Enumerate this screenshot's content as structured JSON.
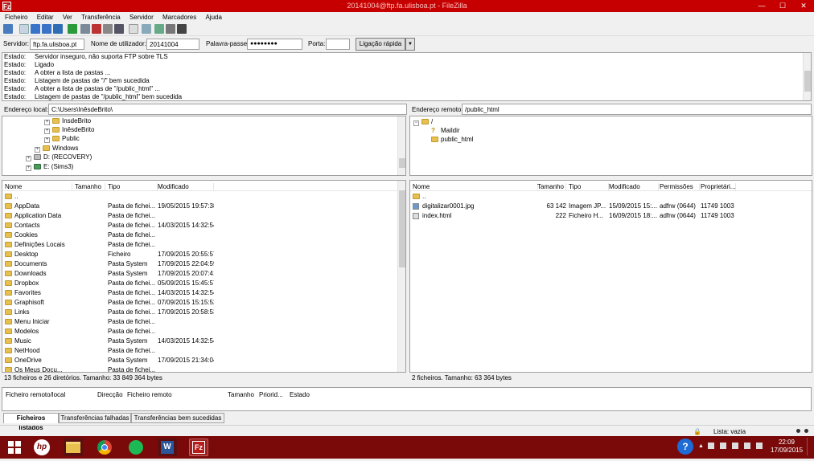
{
  "titlebar": {
    "app_icon": "Fz",
    "title": "20141004@ftp.fa.ulisboa.pt - FileZilla",
    "minimize": "—",
    "maximize": "☐",
    "close": "✕"
  },
  "menu": [
    "Ficheiro",
    "Editar",
    "Ver",
    "Transferência",
    "Servidor",
    "Marcadores",
    "Ajuda"
  ],
  "quickconnect": {
    "host_label": "Servidor:",
    "host_value": "ftp.fa.ulisboa.pt",
    "user_label": "Nome de utilizador:",
    "user_value": "20141004",
    "pass_label": "Palavra-passe:",
    "pass_value": "●●●●●●●●",
    "port_label": "Porta:",
    "port_value": "",
    "connect_label": "Ligação rápida",
    "dropdown_icon": "▼"
  },
  "log": [
    {
      "k": "Estado:",
      "v": "Servidor inseguro, não suporta FTP sobre TLS"
    },
    {
      "k": "Estado:",
      "v": "Ligado"
    },
    {
      "k": "Estado:",
      "v": "A obter a lista de pastas ..."
    },
    {
      "k": "Estado:",
      "v": "Listagem de pastas de \"/\" bem sucedida"
    },
    {
      "k": "Estado:",
      "v": "A obter a lista de pastas de \"/public_html\" ..."
    },
    {
      "k": "Estado:",
      "v": "Listagem de pastas de \"/public_html\" bem sucedida"
    }
  ],
  "local": {
    "addr_label": "Endereço local:",
    "addr_value": "C:\\Users\\InêsdeBrito\\",
    "tree": [
      {
        "label": "InsdeBrito",
        "depth": 5,
        "exp": "+"
      },
      {
        "label": "InêsdeBrito",
        "depth": 5,
        "exp": "+"
      },
      {
        "label": "Public",
        "depth": 5,
        "exp": "+"
      },
      {
        "label": "Windows",
        "depth": 4,
        "exp": "+"
      },
      {
        "label": "D: (RECOVERY)",
        "depth": 3,
        "exp": "+"
      },
      {
        "label": "E: (Sims3)",
        "depth": 3,
        "exp": "+"
      }
    ],
    "columns": [
      "Nome",
      "Tamanho",
      "Tipo",
      "Modificado"
    ],
    "files": [
      {
        "name": "..",
        "size": "",
        "type": "",
        "mod": ""
      },
      {
        "name": "AppData",
        "size": "",
        "type": "Pasta de fichei...",
        "mod": "19/05/2015 19:57:38"
      },
      {
        "name": "Application Data",
        "size": "",
        "type": "Pasta de fichei...",
        "mod": ""
      },
      {
        "name": "Contacts",
        "size": "",
        "type": "Pasta de fichei...",
        "mod": "14/03/2015 14:32:54"
      },
      {
        "name": "Cookies",
        "size": "",
        "type": "Pasta de fichei...",
        "mod": ""
      },
      {
        "name": "Definições Locais",
        "size": "",
        "type": "Pasta de fichei...",
        "mod": ""
      },
      {
        "name": "Desktop",
        "size": "",
        "type": "Ficheiro",
        "mod": "17/09/2015 20:55:57"
      },
      {
        "name": "Documents",
        "size": "",
        "type": "Pasta System",
        "mod": "17/09/2015 22:04:59"
      },
      {
        "name": "Downloads",
        "size": "",
        "type": "Pasta System",
        "mod": "17/09/2015 20:07:41"
      },
      {
        "name": "Dropbox",
        "size": "",
        "type": "Pasta de fichei...",
        "mod": "05/09/2015 15:45:57"
      },
      {
        "name": "Favorites",
        "size": "",
        "type": "Pasta de fichei...",
        "mod": "14/03/2015 14:32:54"
      },
      {
        "name": "Graphisoft",
        "size": "",
        "type": "Pasta de fichei...",
        "mod": "07/09/2015 15:15:52"
      },
      {
        "name": "Links",
        "size": "",
        "type": "Pasta de fichei...",
        "mod": "17/09/2015 20:58:53"
      },
      {
        "name": "Menu Iniciar",
        "size": "",
        "type": "Pasta de fichei...",
        "mod": ""
      },
      {
        "name": "Modelos",
        "size": "",
        "type": "Pasta de fichei...",
        "mod": ""
      },
      {
        "name": "Music",
        "size": "",
        "type": "Pasta System",
        "mod": "14/03/2015 14:32:54"
      },
      {
        "name": "NetHood",
        "size": "",
        "type": "Pasta de fichei...",
        "mod": ""
      },
      {
        "name": "OneDrive",
        "size": "",
        "type": "Pasta System",
        "mod": "17/09/2015 21:34:04"
      },
      {
        "name": "Os Meus Docu...",
        "size": "",
        "type": "Pasta de fichei...",
        "mod": ""
      }
    ],
    "status": "13 ficheiros e 26 diretórios. Tamanho: 33 849 364 bytes"
  },
  "remote": {
    "addr_label": "Endereço remoto:",
    "addr_value": "/public_html",
    "tree": [
      {
        "label": "/",
        "depth": 0,
        "exp": "−",
        "icon": "folder"
      },
      {
        "label": "Maildir",
        "depth": 1,
        "exp": "",
        "icon": "question"
      },
      {
        "label": "public_html",
        "depth": 1,
        "exp": "",
        "icon": "folder"
      }
    ],
    "columns": [
      "Nome",
      "Tamanho",
      "Tipo",
      "Modificado",
      "Permissões",
      "Proprietári..."
    ],
    "files": [
      {
        "name": "..",
        "size": "",
        "type": "",
        "mod": "",
        "perm": "",
        "owner": ""
      },
      {
        "name": "digitalizar0001.jpg",
        "size": "63 142",
        "type": "Imagem JP...",
        "mod": "15/09/2015 15:...",
        "perm": "adfrw (0644)",
        "owner": "11749 1003"
      },
      {
        "name": "index.html",
        "size": "222",
        "type": "Ficheiro H...",
        "mod": "16/09/2015 18:...",
        "perm": "adfrw (0644)",
        "owner": "11749 1003"
      }
    ],
    "status": "2 ficheiros. Tamanho: 63 364 bytes"
  },
  "queue": {
    "columns": [
      "Ficheiro remoto/local",
      "Direcção",
      "Ficheiro remoto",
      "Tamanho",
      "Priorid...",
      "Estado"
    ]
  },
  "tabs": [
    "Ficheiros listados",
    "Transferências falhadas",
    "Transferências bem sucedidas"
  ],
  "statusbar": {
    "queue": "Lista: vazia"
  },
  "taskbar": {
    "time": "22:09",
    "date": "17/09/2015",
    "apps": [
      "windows",
      "hp",
      "explorer",
      "chrome",
      "spotify",
      "word",
      "filezilla"
    ]
  }
}
